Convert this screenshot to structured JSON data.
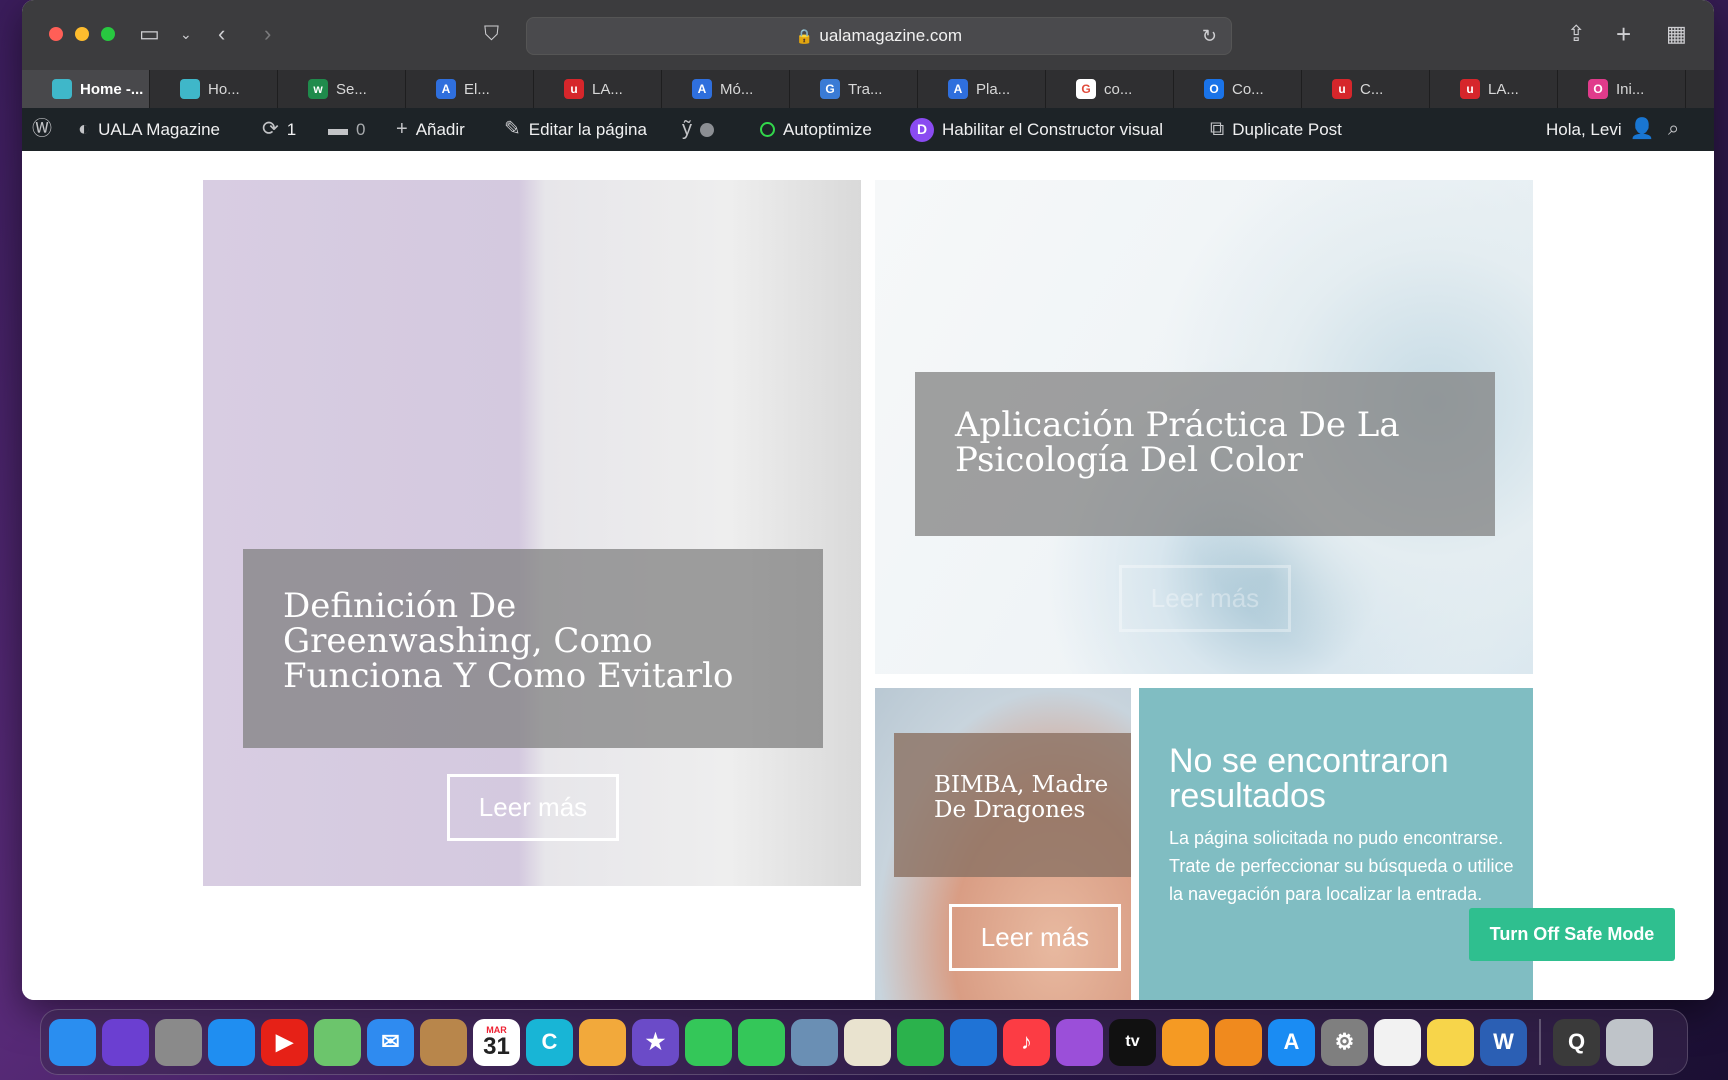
{
  "browser": {
    "url": "ualamagazine.com",
    "tabs": [
      {
        "label": "Home -...",
        "icon_color": "#3fb7c9",
        "icon_char": ""
      },
      {
        "label": "Ho...",
        "icon_color": "#3fb7c9",
        "icon_char": ""
      },
      {
        "label": "Se...",
        "icon_color": "#1f8b4c",
        "icon_char": "w"
      },
      {
        "label": "El...",
        "icon_color": "#2f6fdd",
        "icon_char": "A"
      },
      {
        "label": "LA...",
        "icon_color": "#d6262b",
        "icon_char": "u"
      },
      {
        "label": "Mó...",
        "icon_color": "#2f6fdd",
        "icon_char": "A"
      },
      {
        "label": "Tra...",
        "icon_color": "#3a7bd5",
        "icon_char": "G"
      },
      {
        "label": "Pla...",
        "icon_color": "#2f6fdd",
        "icon_char": "A"
      },
      {
        "label": "co...",
        "icon_color": "#ffffff",
        "icon_char": "G"
      },
      {
        "label": "Co...",
        "icon_color": "#1a73e8",
        "icon_char": "O"
      },
      {
        "label": "C...",
        "icon_color": "#d6262b",
        "icon_char": "u"
      },
      {
        "label": "LA...",
        "icon_color": "#d6262b",
        "icon_char": "u"
      },
      {
        "label": "Ini...",
        "icon_color": "#e03b8b",
        "icon_char": "O"
      }
    ]
  },
  "adminbar": {
    "site_name": "UALA Magazine",
    "updates_count": "1",
    "comments_count": "0",
    "add_label": "Añadir",
    "edit_label": "Editar la página",
    "autoptimize_label": "Autoptimize",
    "divi_label": "Habilitar el Constructor visual",
    "duplicate_label": "Duplicate Post",
    "greeting": "Hola, Levi"
  },
  "posts": {
    "left_title": "Definición De Greenwashing, Como Funciona Y Como Evitarlo",
    "right_title": "Aplicación Práctica De La Psicología Del Color",
    "egg_title": "BIMBA, Madre De Dragones",
    "read_more": "Leer más"
  },
  "not_found": {
    "title": "No se encontraron resultados",
    "text": "La página solicitada no pudo encontrarse. Trate de perfeccionar su búsqueda o utilice la navegación para localizar la entrada."
  },
  "safe_mode_label": "Turn Off Safe Mode",
  "dock": {
    "calendar_month": "MAR",
    "calendar_day": "31",
    "tv_label": "tv",
    "apps": [
      {
        "name": "finder",
        "color": "#2a8ef0",
        "char": ""
      },
      {
        "name": "siri",
        "color": "#6b3fd1",
        "char": ""
      },
      {
        "name": "launchpad",
        "color": "#8a8a8a",
        "char": ""
      },
      {
        "name": "safari",
        "color": "#1f8ef1",
        "char": ""
      },
      {
        "name": "youtube",
        "color": "#e62117",
        "char": "▶"
      },
      {
        "name": "maps",
        "color": "#6cc56c",
        "char": ""
      },
      {
        "name": "mail",
        "color": "#2f8bf0",
        "char": "✉"
      },
      {
        "name": "contacts",
        "color": "#b8864b",
        "char": ""
      },
      {
        "name": "calendar",
        "color": "#ffffff",
        "char": ""
      },
      {
        "name": "canva",
        "color": "#18b5d6",
        "char": "C"
      },
      {
        "name": "photos",
        "color": "#f2a93b",
        "char": ""
      },
      {
        "name": "imovie",
        "color": "#6b4bc8",
        "char": "★"
      },
      {
        "name": "messages",
        "color": "#34c759",
        "char": ""
      },
      {
        "name": "facetime",
        "color": "#34c759",
        "char": ""
      },
      {
        "name": "preview",
        "color": "#6a8fb4",
        "char": ""
      },
      {
        "name": "textedit",
        "color": "#e9e3cf",
        "char": ""
      },
      {
        "name": "numbers",
        "color": "#2bb24c",
        "char": ""
      },
      {
        "name": "keynote",
        "color": "#1f73d6",
        "char": ""
      },
      {
        "name": "music",
        "color": "#fc3c44",
        "char": "♪"
      },
      {
        "name": "podcasts",
        "color": "#9b4fd9",
        "char": ""
      },
      {
        "name": "tv",
        "color": "#111111",
        "char": ""
      },
      {
        "name": "pages",
        "color": "#f59a23",
        "char": ""
      },
      {
        "name": "books",
        "color": "#f08a1e",
        "char": ""
      },
      {
        "name": "app-store",
        "color": "#1a8cf3",
        "char": "A"
      },
      {
        "name": "system-preferences",
        "color": "#7f7f7f",
        "char": "⚙"
      },
      {
        "name": "reminders",
        "color": "#f2f2f2",
        "char": ""
      },
      {
        "name": "notes",
        "color": "#f7d54a",
        "char": ""
      },
      {
        "name": "word",
        "color": "#2b5fb4",
        "char": "W"
      },
      {
        "name": "quicktime",
        "color": "#3a3a3a",
        "char": "Q"
      },
      {
        "name": "trash",
        "color": "#bfc4c9",
        "char": ""
      }
    ]
  }
}
